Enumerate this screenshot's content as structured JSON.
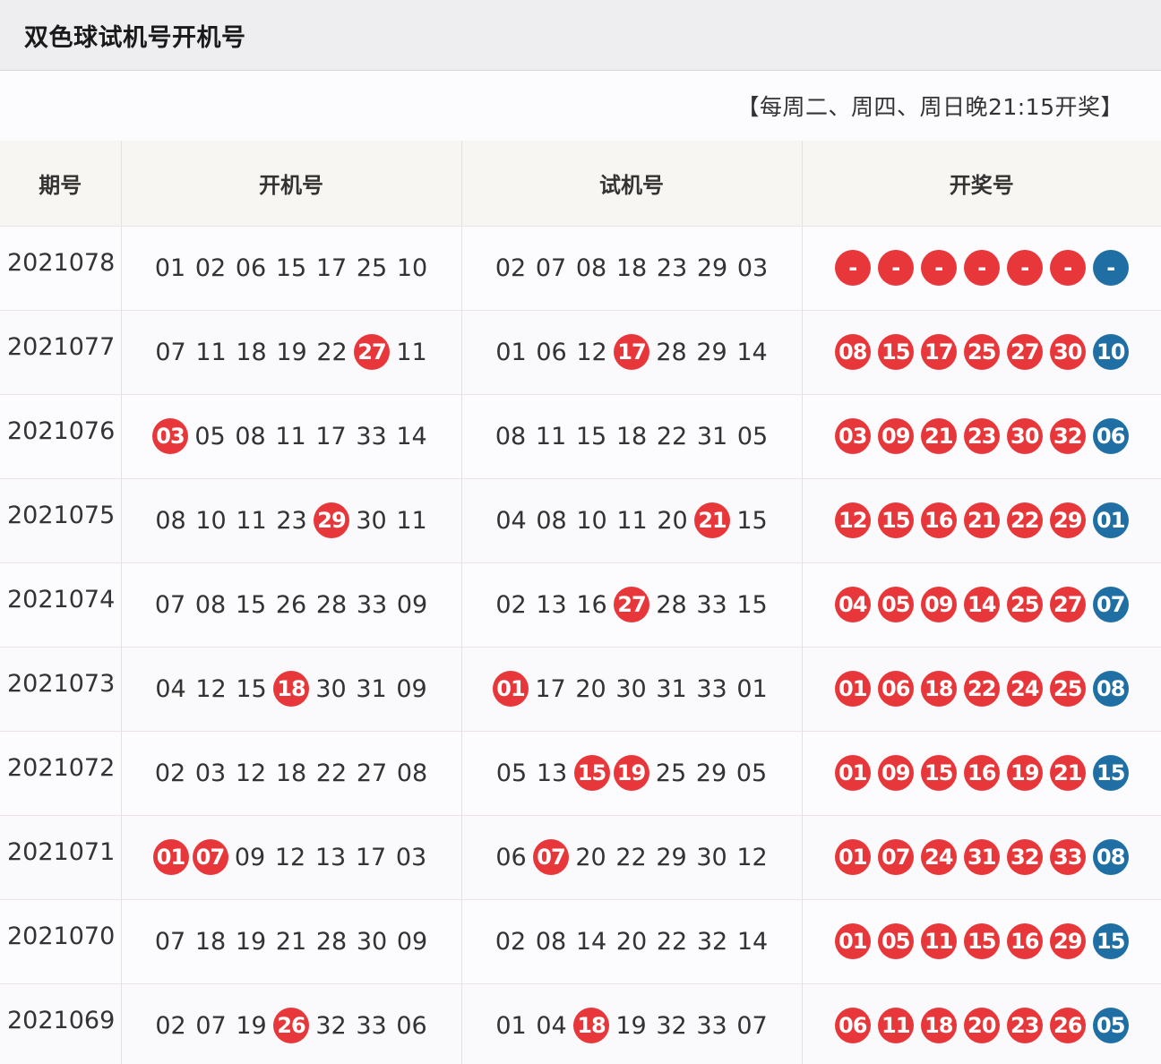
{
  "page": {
    "title": "双色球试机号开机号",
    "schedule": "【每周二、周四、周日晚21:15开奖】"
  },
  "colors": {
    "red_ball": "#e8373a",
    "blue_ball": "#1f6fa5"
  },
  "table": {
    "headers": [
      "期号",
      "开机号",
      "试机号",
      "开奖号"
    ],
    "rows": [
      {
        "period": "2021078",
        "open": [
          [
            "01",
            false
          ],
          [
            "02",
            false
          ],
          [
            "06",
            false
          ],
          [
            "15",
            false
          ],
          [
            "17",
            false
          ],
          [
            "25",
            false
          ],
          [
            "10",
            false
          ]
        ],
        "trial": [
          [
            "02",
            false
          ],
          [
            "07",
            false
          ],
          [
            "08",
            false
          ],
          [
            "18",
            false
          ],
          [
            "23",
            false
          ],
          [
            "29",
            false
          ],
          [
            "03",
            false
          ]
        ],
        "reds": [
          "-",
          "-",
          "-",
          "-",
          "-",
          "-"
        ],
        "blue": "-"
      },
      {
        "period": "2021077",
        "open": [
          [
            "07",
            false
          ],
          [
            "11",
            false
          ],
          [
            "18",
            false
          ],
          [
            "19",
            false
          ],
          [
            "22",
            false
          ],
          [
            "27",
            true
          ],
          [
            "11",
            false
          ]
        ],
        "trial": [
          [
            "01",
            false
          ],
          [
            "06",
            false
          ],
          [
            "12",
            false
          ],
          [
            "17",
            true
          ],
          [
            "28",
            false
          ],
          [
            "29",
            false
          ],
          [
            "14",
            false
          ]
        ],
        "reds": [
          "08",
          "15",
          "17",
          "25",
          "27",
          "30"
        ],
        "blue": "10"
      },
      {
        "period": "2021076",
        "open": [
          [
            "03",
            true
          ],
          [
            "05",
            false
          ],
          [
            "08",
            false
          ],
          [
            "11",
            false
          ],
          [
            "17",
            false
          ],
          [
            "33",
            false
          ],
          [
            "14",
            false
          ]
        ],
        "trial": [
          [
            "08",
            false
          ],
          [
            "11",
            false
          ],
          [
            "15",
            false
          ],
          [
            "18",
            false
          ],
          [
            "22",
            false
          ],
          [
            "31",
            false
          ],
          [
            "05",
            false
          ]
        ],
        "reds": [
          "03",
          "09",
          "21",
          "23",
          "30",
          "32"
        ],
        "blue": "06"
      },
      {
        "period": "2021075",
        "open": [
          [
            "08",
            false
          ],
          [
            "10",
            false
          ],
          [
            "11",
            false
          ],
          [
            "23",
            false
          ],
          [
            "29",
            true
          ],
          [
            "30",
            false
          ],
          [
            "11",
            false
          ]
        ],
        "trial": [
          [
            "04",
            false
          ],
          [
            "08",
            false
          ],
          [
            "10",
            false
          ],
          [
            "11",
            false
          ],
          [
            "20",
            false
          ],
          [
            "21",
            true
          ],
          [
            "15",
            false
          ]
        ],
        "reds": [
          "12",
          "15",
          "16",
          "21",
          "22",
          "29"
        ],
        "blue": "01"
      },
      {
        "period": "2021074",
        "open": [
          [
            "07",
            false
          ],
          [
            "08",
            false
          ],
          [
            "15",
            false
          ],
          [
            "26",
            false
          ],
          [
            "28",
            false
          ],
          [
            "33",
            false
          ],
          [
            "09",
            false
          ]
        ],
        "trial": [
          [
            "02",
            false
          ],
          [
            "13",
            false
          ],
          [
            "16",
            false
          ],
          [
            "27",
            true
          ],
          [
            "28",
            false
          ],
          [
            "33",
            false
          ],
          [
            "15",
            false
          ]
        ],
        "reds": [
          "04",
          "05",
          "09",
          "14",
          "25",
          "27"
        ],
        "blue": "07"
      },
      {
        "period": "2021073",
        "open": [
          [
            "04",
            false
          ],
          [
            "12",
            false
          ],
          [
            "15",
            false
          ],
          [
            "18",
            true
          ],
          [
            "30",
            false
          ],
          [
            "31",
            false
          ],
          [
            "09",
            false
          ]
        ],
        "trial": [
          [
            "01",
            true
          ],
          [
            "17",
            false
          ],
          [
            "20",
            false
          ],
          [
            "30",
            false
          ],
          [
            "31",
            false
          ],
          [
            "33",
            false
          ],
          [
            "01",
            false
          ]
        ],
        "reds": [
          "01",
          "06",
          "18",
          "22",
          "24",
          "25"
        ],
        "blue": "08"
      },
      {
        "period": "2021072",
        "open": [
          [
            "02",
            false
          ],
          [
            "03",
            false
          ],
          [
            "12",
            false
          ],
          [
            "18",
            false
          ],
          [
            "22",
            false
          ],
          [
            "27",
            false
          ],
          [
            "08",
            false
          ]
        ],
        "trial": [
          [
            "05",
            false
          ],
          [
            "13",
            false
          ],
          [
            "15",
            true
          ],
          [
            "19",
            true
          ],
          [
            "25",
            false
          ],
          [
            "29",
            false
          ],
          [
            "05",
            false
          ]
        ],
        "reds": [
          "01",
          "09",
          "15",
          "16",
          "19",
          "21"
        ],
        "blue": "15"
      },
      {
        "period": "2021071",
        "open": [
          [
            "01",
            true
          ],
          [
            "07",
            true
          ],
          [
            "09",
            false
          ],
          [
            "12",
            false
          ],
          [
            "13",
            false
          ],
          [
            "17",
            false
          ],
          [
            "03",
            false
          ]
        ],
        "trial": [
          [
            "06",
            false
          ],
          [
            "07",
            true
          ],
          [
            "20",
            false
          ],
          [
            "22",
            false
          ],
          [
            "29",
            false
          ],
          [
            "30",
            false
          ],
          [
            "12",
            false
          ]
        ],
        "reds": [
          "01",
          "07",
          "24",
          "31",
          "32",
          "33"
        ],
        "blue": "08"
      },
      {
        "period": "2021070",
        "open": [
          [
            "07",
            false
          ],
          [
            "18",
            false
          ],
          [
            "19",
            false
          ],
          [
            "21",
            false
          ],
          [
            "28",
            false
          ],
          [
            "30",
            false
          ],
          [
            "09",
            false
          ]
        ],
        "trial": [
          [
            "02",
            false
          ],
          [
            "08",
            false
          ],
          [
            "14",
            false
          ],
          [
            "20",
            false
          ],
          [
            "22",
            false
          ],
          [
            "32",
            false
          ],
          [
            "14",
            false
          ]
        ],
        "reds": [
          "01",
          "05",
          "11",
          "15",
          "16",
          "29"
        ],
        "blue": "15"
      },
      {
        "period": "2021069",
        "open": [
          [
            "02",
            false
          ],
          [
            "07",
            false
          ],
          [
            "19",
            false
          ],
          [
            "26",
            true
          ],
          [
            "32",
            false
          ],
          [
            "33",
            false
          ],
          [
            "06",
            false
          ]
        ],
        "trial": [
          [
            "01",
            false
          ],
          [
            "04",
            false
          ],
          [
            "18",
            true
          ],
          [
            "19",
            false
          ],
          [
            "32",
            false
          ],
          [
            "33",
            false
          ],
          [
            "07",
            false
          ]
        ],
        "reds": [
          "06",
          "11",
          "18",
          "20",
          "23",
          "26"
        ],
        "blue": "05"
      }
    ]
  }
}
